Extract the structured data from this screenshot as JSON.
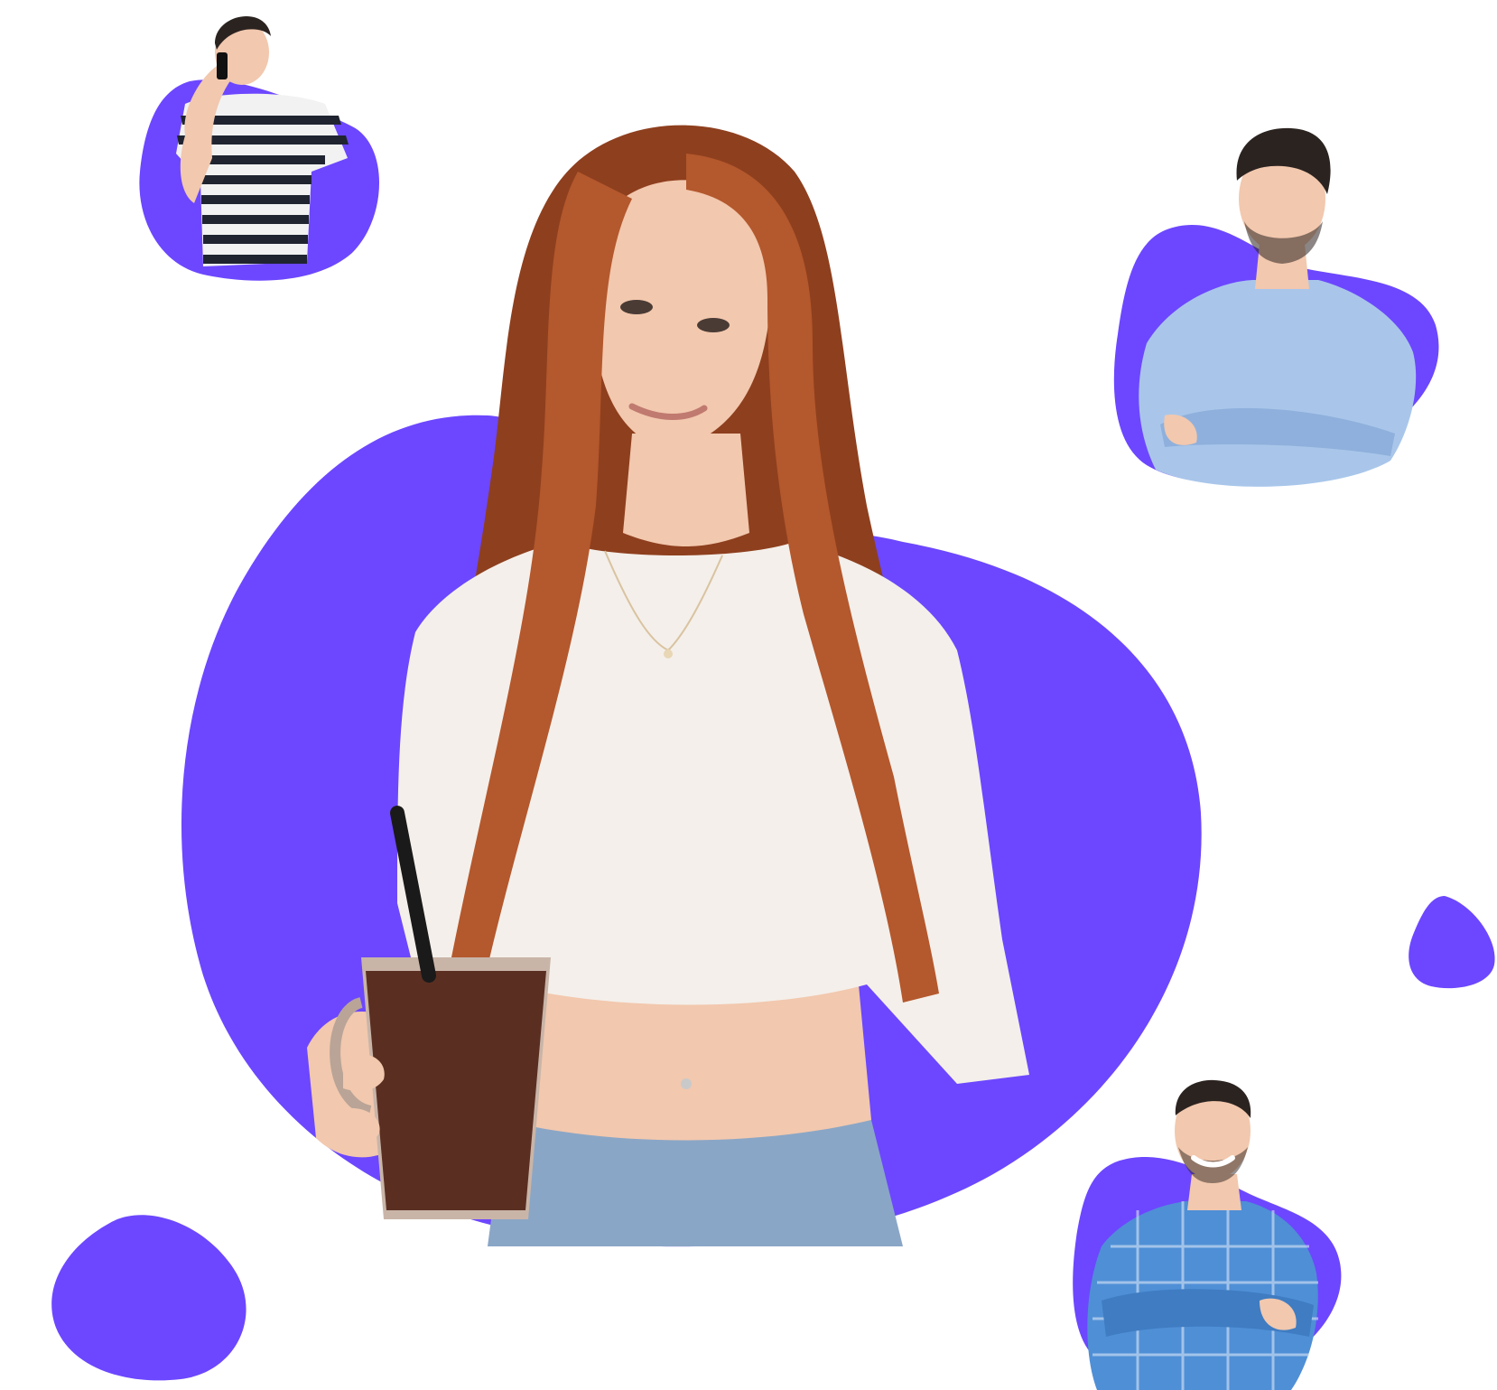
{
  "colors": {
    "background": "#ffffff",
    "blob": "#6c47ff",
    "skin": "#f2c8ae",
    "skin_shadow": "#e0a98a",
    "red_hair": "#b4582d",
    "red_hair_dark": "#8e3f1e",
    "white_top": "#f4efea",
    "dark_hair": "#2b2320",
    "stripe_dark": "#1f2430",
    "stripe_light": "#f2f2f2",
    "light_blue_shirt": "#a9c6ea",
    "plaid_blue": "#4f8fd6",
    "drink": "#5a2f22",
    "glass": "#c9b5a8",
    "jeans": "#8aa6c6"
  },
  "scene": {
    "main_person": "woman-holding-drink",
    "avatars": [
      "man-on-phone-striped-shirt",
      "man-light-blue-shirt-arms-crossed",
      "man-blue-plaid-shirt-arms-crossed"
    ],
    "decorations": [
      "small-blob-left",
      "small-blob-right"
    ]
  }
}
